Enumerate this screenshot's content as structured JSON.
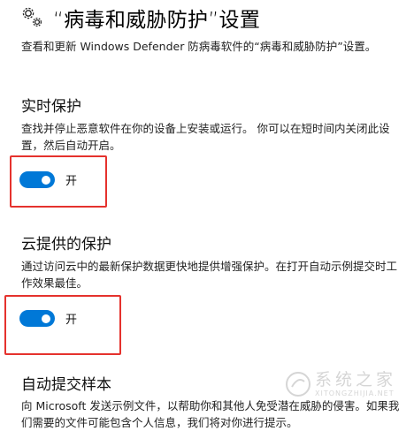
{
  "header": {
    "title": "“病毒和威胁防护”设置",
    "icon": "gear-icon",
    "description": "查看和更新 Windows Defender 防病毒软件的“病毒和威胁防护”设置。"
  },
  "sections": {
    "realtime": {
      "title": "实时保护",
      "description": "查找并停止恶意软件在你的设备上安装或运行。 你可以在短时间内关闭此设置，然后自动开启。",
      "toggle_state": "开",
      "toggle_on": true
    },
    "cloud": {
      "title": "云提供的保护",
      "description": "通过访问云中的最新保护数据更快地提供增强保护。在打开自动示例提交时工作效果最佳。",
      "toggle_state": "开",
      "toggle_on": true
    },
    "sample": {
      "title": "自动提交样本",
      "description": "向 Microsoft 发送示例文件，以帮助你和其他人免受潜在威胁的侵害。如果我们需要的文件可能包含个人信息，我们将对你进行提示。"
    }
  },
  "watermark": {
    "text": "系统之家",
    "subtext": "XITONGZHIJIA.NET"
  },
  "colors": {
    "accent": "#0078d7",
    "highlight": "#e5322d"
  }
}
